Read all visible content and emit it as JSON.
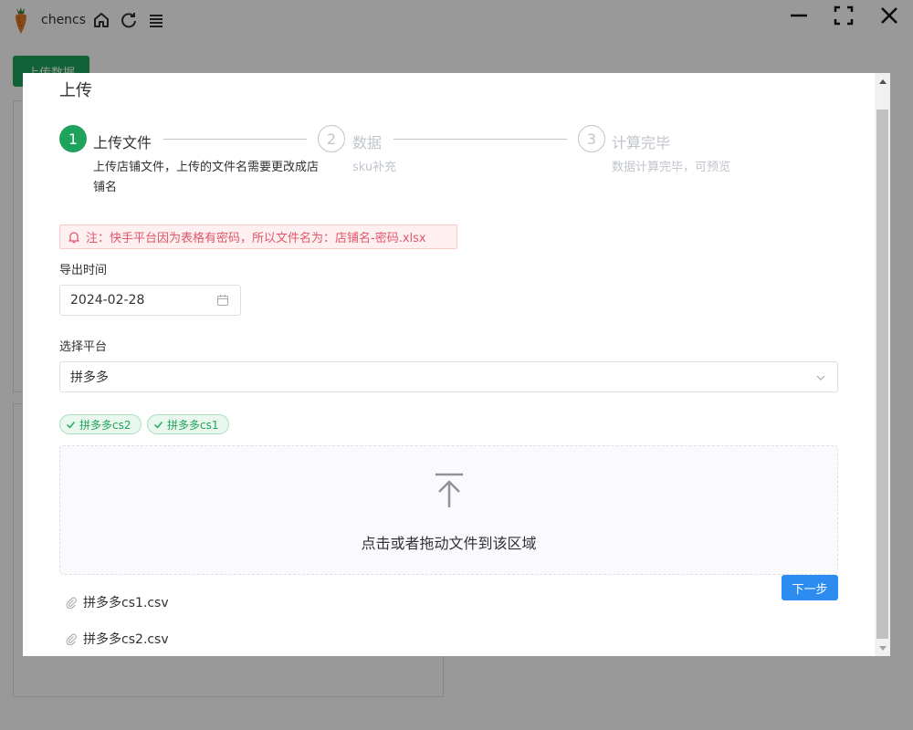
{
  "app": {
    "username": "chencs",
    "upload_button_label": "上传数据"
  },
  "dialog": {
    "title": "上传",
    "steps": [
      {
        "number": "1",
        "title": "上传文件",
        "description": "上传店铺文件，上传的文件名需要更改成店铺名",
        "status": "active"
      },
      {
        "number": "2",
        "title": "数据",
        "description": "sku补充",
        "status": "wait"
      },
      {
        "number": "3",
        "title": "计算完毕",
        "description": "数据计算完毕，可预览",
        "status": "wait"
      }
    ],
    "alert_text": "注：快手平台因为表格有密码，所以文件名为：店铺名-密码.xlsx",
    "export_time": {
      "label": "导出时间",
      "value": "2024-02-28"
    },
    "platform": {
      "label": "选择平台",
      "value": "拼多多"
    },
    "tags": [
      "拼多多cs2",
      "拼多多cs1"
    ],
    "dropzone_text": "点击或者拖动文件到该区域",
    "next_button_label": "下一步",
    "files": [
      "拼多多cs1.csv",
      "拼多多cs2.csv"
    ]
  },
  "colors": {
    "primary_green": "#1fa35c",
    "primary_blue": "#2d8cf0",
    "alert_red": "#e0566b"
  }
}
